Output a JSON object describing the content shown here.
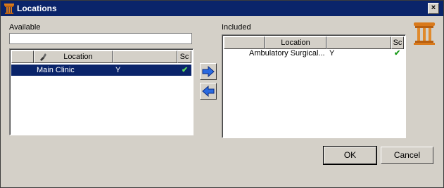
{
  "window": {
    "title": "Locations",
    "close_label": "×"
  },
  "available": {
    "label": "Available",
    "filter_value": "",
    "columns": [
      "",
      "Location",
      "",
      "Sc"
    ],
    "rows": [
      {
        "location": "Main Clinic",
        "flag": "Y",
        "sc": "✔",
        "selected": true
      }
    ]
  },
  "included": {
    "label": "Included",
    "columns": [
      "",
      "Location",
      "",
      "Sc"
    ],
    "rows": [
      {
        "location": "Ambulatory Surgical...",
        "flag": "Y",
        "sc": "✔",
        "selected": false
      }
    ]
  },
  "buttons": {
    "ok": "OK",
    "cancel": "Cancel"
  },
  "colors": {
    "title_bg": "#0a246a",
    "selection_bg": "#0a246a",
    "check": "#1a9a1a",
    "arrow": "#2a6ae0",
    "pillar": "#d97a1c"
  },
  "icons": [
    "app-pillar-icon",
    "close-icon",
    "flashlight-icon",
    "check-icon",
    "arrow-right-icon",
    "arrow-left-icon",
    "pillar-logo-icon"
  ]
}
